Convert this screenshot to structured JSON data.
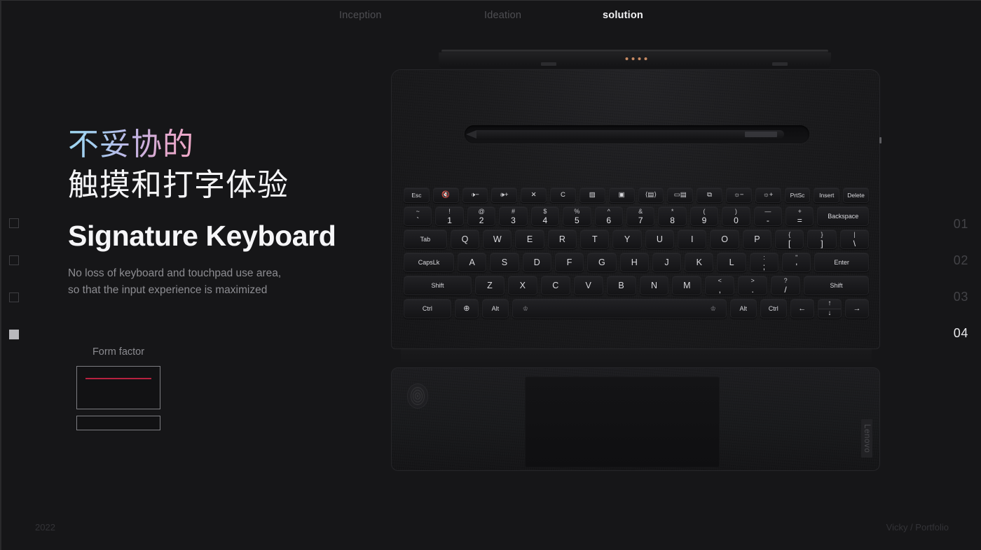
{
  "theme": {
    "background": "#161618",
    "accent_red": "#b6213f",
    "pogo_pin": "#c78a63",
    "gradient_start": "#9ed9f2",
    "gradient_mid": "#c3b4e4",
    "gradient_end": "#f0a9c6",
    "text_primary": "#f4f4f6",
    "text_muted": "#8d8d92"
  },
  "topnav": {
    "items": [
      {
        "label": "Inception",
        "active": false
      },
      {
        "label": "Ideation",
        "active": false
      },
      {
        "label": "solution",
        "active": true
      }
    ]
  },
  "markers": [
    {
      "active": false
    },
    {
      "active": false
    },
    {
      "active": false
    },
    {
      "active": true
    }
  ],
  "index_numbers": [
    {
      "label": "01",
      "active": false
    },
    {
      "label": "02",
      "active": false
    },
    {
      "label": "03",
      "active": false
    },
    {
      "label": "04",
      "active": true
    }
  ],
  "copy": {
    "headline_gradient": "不妥协的",
    "headline_white": "触摸和打字体验",
    "title_en": "Signature Keyboard",
    "subcopy_line1": "No loss of keyboard and touchpad use area,",
    "subcopy_line2": "so that the input experience is maximized"
  },
  "form_factor": {
    "label": "Form factor"
  },
  "device": {
    "brand": "Lenovo",
    "keyboard_rows": [
      {
        "name": "function-row",
        "keys": [
          {
            "label": "Esc",
            "icon": "escape-key",
            "type": "text"
          },
          {
            "label": "🔇",
            "icon": "mute-icon",
            "type": "glyph"
          },
          {
            "label": "🕩−",
            "icon": "volume-down-icon",
            "type": "glyph"
          },
          {
            "label": "🕪+",
            "icon": "volume-up-icon",
            "type": "glyph"
          },
          {
            "label": "✕",
            "icon": "close-window-icon",
            "type": "glyph"
          },
          {
            "label": "C",
            "icon": "refresh-icon",
            "type": "glyph"
          },
          {
            "label": "▨",
            "icon": "screen-off-icon",
            "type": "glyph"
          },
          {
            "label": "▣",
            "icon": "camera-icon",
            "type": "glyph"
          },
          {
            "label": "⟨▤⟩",
            "icon": "microphone-icon",
            "type": "glyph"
          },
          {
            "label": "▭▤",
            "icon": "display-switch-icon",
            "type": "glyph"
          },
          {
            "label": "⧉",
            "icon": "task-view-icon",
            "type": "glyph"
          },
          {
            "label": "☼−",
            "icon": "brightness-down-icon",
            "type": "glyph"
          },
          {
            "label": "☼+",
            "icon": "brightness-up-icon",
            "type": "glyph"
          },
          {
            "label": "PrtSc",
            "icon": "print-screen-key",
            "type": "text"
          },
          {
            "label": "Insert",
            "icon": "insert-key",
            "type": "text"
          },
          {
            "label": "Delete",
            "icon": "delete-key",
            "type": "text"
          }
        ]
      },
      {
        "name": "number-row",
        "keys": [
          {
            "top": "~",
            "bot": "`",
            "type": "dual"
          },
          {
            "top": "!",
            "bot": "1",
            "type": "dual"
          },
          {
            "top": "@",
            "bot": "2",
            "type": "dual"
          },
          {
            "top": "#",
            "bot": "3",
            "type": "dual"
          },
          {
            "top": "$",
            "bot": "4",
            "type": "dual"
          },
          {
            "top": "%",
            "bot": "5",
            "type": "dual"
          },
          {
            "top": "^",
            "bot": "6",
            "type": "dual"
          },
          {
            "top": "&",
            "bot": "7",
            "type": "dual"
          },
          {
            "top": "*",
            "bot": "8",
            "type": "dual"
          },
          {
            "top": "(",
            "bot": "9",
            "type": "dual"
          },
          {
            "top": ")",
            "bot": "0",
            "type": "dual"
          },
          {
            "top": "—",
            "bot": "-",
            "type": "dual"
          },
          {
            "top": "+",
            "bot": "=",
            "type": "dual"
          },
          {
            "label": "Backspace",
            "type": "text",
            "width": "wide-bksp"
          }
        ]
      },
      {
        "name": "tab-row",
        "keys": [
          {
            "label": "Tab",
            "type": "text",
            "width": "wide-tab"
          },
          {
            "label": "Q",
            "type": "text"
          },
          {
            "label": "W",
            "type": "text"
          },
          {
            "label": "E",
            "type": "text"
          },
          {
            "label": "R",
            "type": "text"
          },
          {
            "label": "T",
            "type": "text"
          },
          {
            "label": "Y",
            "type": "text"
          },
          {
            "label": "U",
            "type": "text"
          },
          {
            "label": "I",
            "type": "text"
          },
          {
            "label": "O",
            "type": "text"
          },
          {
            "label": "P",
            "type": "text"
          },
          {
            "top": "{",
            "bot": "[",
            "type": "dual"
          },
          {
            "top": "}",
            "bot": "]",
            "type": "dual"
          },
          {
            "top": "|",
            "bot": "\\",
            "type": "dual"
          }
        ]
      },
      {
        "name": "home-row",
        "keys": [
          {
            "label": "CapsLk",
            "type": "text",
            "width": "wide-caps"
          },
          {
            "label": "A",
            "type": "text"
          },
          {
            "label": "S",
            "type": "text"
          },
          {
            "label": "D",
            "type": "text"
          },
          {
            "label": "F",
            "type": "text"
          },
          {
            "label": "G",
            "type": "text"
          },
          {
            "label": "H",
            "type": "text"
          },
          {
            "label": "J",
            "type": "text"
          },
          {
            "label": "K",
            "type": "text"
          },
          {
            "label": "L",
            "type": "text"
          },
          {
            "top": ":",
            "bot": ";",
            "type": "dual"
          },
          {
            "top": "\"",
            "bot": "'",
            "type": "dual"
          },
          {
            "label": "Enter",
            "type": "text",
            "width": "wide-enter"
          }
        ]
      },
      {
        "name": "shift-row",
        "keys": [
          {
            "label": "Shift",
            "type": "text",
            "width": "wide-shiftl"
          },
          {
            "label": "Z",
            "type": "text"
          },
          {
            "label": "X",
            "type": "text"
          },
          {
            "label": "C",
            "type": "text"
          },
          {
            "label": "V",
            "type": "text"
          },
          {
            "label": "B",
            "type": "text"
          },
          {
            "label": "N",
            "type": "text"
          },
          {
            "label": "M",
            "type": "text"
          },
          {
            "top": "<",
            "bot": ",",
            "type": "dual"
          },
          {
            "top": ">",
            "bot": ".",
            "type": "dual"
          },
          {
            "top": "?",
            "bot": "/",
            "type": "dual"
          },
          {
            "label": "Shift",
            "type": "text",
            "width": "wide-shiftr"
          }
        ]
      },
      {
        "name": "bottom-row",
        "keys": [
          {
            "label": "Ctrl",
            "type": "text",
            "width": "wide-ctrl"
          },
          {
            "label": "⊕",
            "icon": "globe-fn-icon",
            "type": "glyph"
          },
          {
            "label": "Alt",
            "type": "text",
            "width": "wide-alt"
          },
          {
            "label": "",
            "icon": "spacebar",
            "type": "space",
            "mark": "♔"
          },
          {
            "label": "Alt",
            "type": "text",
            "width": "wide-alt"
          },
          {
            "label": "Ctrl",
            "type": "text",
            "width": "wide-alt"
          },
          {
            "label": "←",
            "icon": "arrow-left-icon",
            "type": "glyph"
          },
          {
            "label": "↑",
            "label2": "↓",
            "icon": "arrow-up-down-icon",
            "type": "updown"
          },
          {
            "label": "→",
            "icon": "arrow-right-icon",
            "type": "glyph"
          }
        ]
      }
    ]
  },
  "footer": {
    "year": "2022",
    "credit": "Vicky / Portfolio"
  }
}
